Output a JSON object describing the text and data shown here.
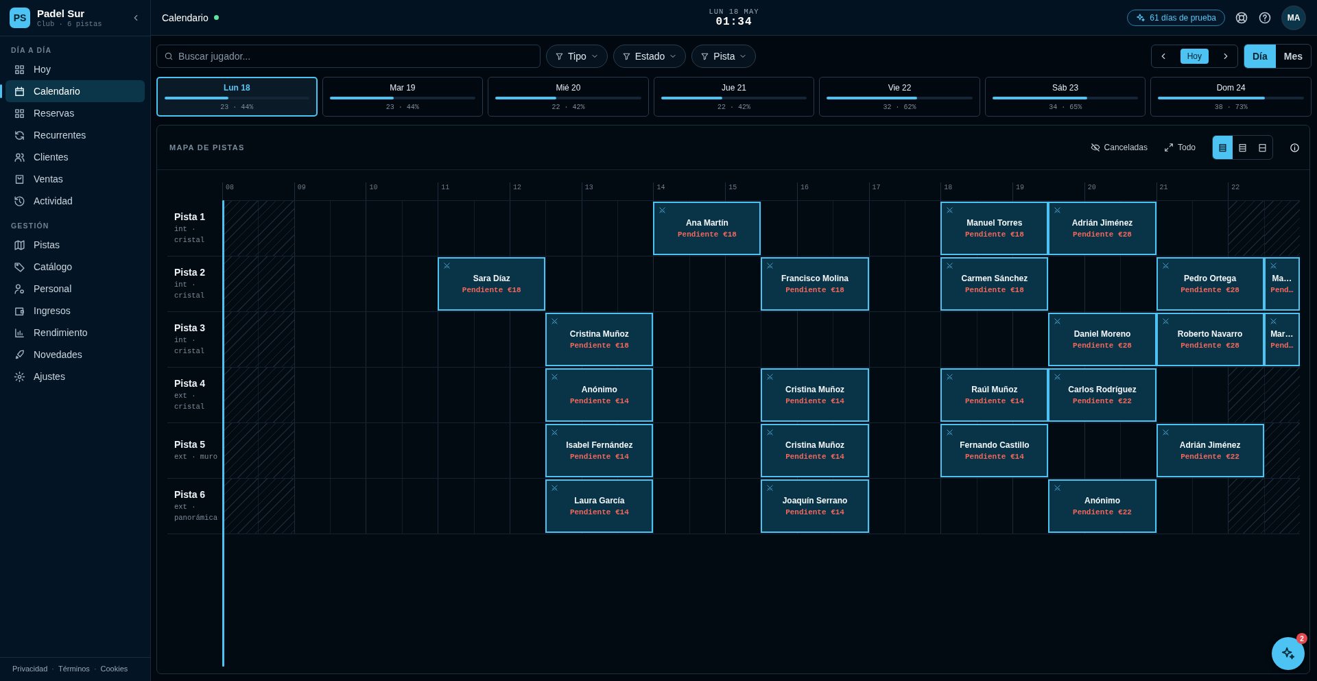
{
  "sidebar": {
    "logo": "PS",
    "club": "Padel Sur",
    "subtitle": "Club · 6 pistas",
    "sections": [
      {
        "title": "DÍA A DÍA",
        "items": [
          {
            "label": "Hoy",
            "selected": false
          },
          {
            "label": "Calendario",
            "selected": true
          },
          {
            "label": "Reservas",
            "selected": false
          },
          {
            "label": "Recurrentes",
            "selected": false
          },
          {
            "label": "Clientes",
            "selected": false
          },
          {
            "label": "Ventas",
            "selected": false
          },
          {
            "label": "Actividad",
            "selected": false
          }
        ]
      },
      {
        "title": "GESTIÓN",
        "items": [
          {
            "label": "Pistas",
            "selected": false
          },
          {
            "label": "Catálogo",
            "selected": false
          },
          {
            "label": "Personal",
            "selected": false
          },
          {
            "label": "Ingresos",
            "selected": false
          },
          {
            "label": "Rendimiento",
            "selected": false
          },
          {
            "label": "Novedades",
            "selected": false
          },
          {
            "label": "Ajustes",
            "selected": false
          }
        ]
      }
    ],
    "footer_links": [
      "Privacidad",
      "Términos",
      "Cookies"
    ],
    "separator": "·"
  },
  "header": {
    "title": "Calendario",
    "date": "LUN 18 MAY",
    "time": "01:34",
    "trial": "61 días de prueba",
    "avatar": "MA"
  },
  "toolbar": {
    "search": {
      "placeholder": "Buscar jugador..."
    },
    "filters": [
      "Tipo",
      "Estado",
      "Pista"
    ],
    "today": "Hoy",
    "views": [
      {
        "label": "Día",
        "selected": true
      },
      {
        "label": "Mes",
        "selected": false
      }
    ]
  },
  "days": [
    {
      "label": "Lun 18",
      "stats": "23 · 44%",
      "level": 0.44,
      "selected": true
    },
    {
      "label": "Mar 19",
      "stats": "23 · 44%",
      "level": 0.44,
      "selected": false
    },
    {
      "label": "Mié 20",
      "stats": "22 · 42%",
      "level": 0.42,
      "selected": false
    },
    {
      "label": "Jue 21",
      "stats": "22 · 42%",
      "level": 0.42,
      "selected": false
    },
    {
      "label": "Vie 22",
      "stats": "32 · 62%",
      "level": 0.62,
      "selected": false
    },
    {
      "label": "Sáb 23",
      "stats": "34 · 65%",
      "level": 0.65,
      "selected": false
    },
    {
      "label": "Dom 24",
      "stats": "38 · 73%",
      "level": 0.73,
      "selected": false
    }
  ],
  "map": {
    "title": "MAPA DE PISTAS",
    "actions": [
      "Canceladas",
      "Todo"
    ],
    "densities": [
      {
        "selected": true
      },
      {
        "selected": false
      },
      {
        "selected": false
      }
    ],
    "hours": [
      "08",
      "09",
      "10",
      "11",
      "12",
      "13",
      "14",
      "15",
      "16",
      "17",
      "18",
      "19",
      "20",
      "21",
      "22"
    ],
    "courts": [
      {
        "name": "Pista 1",
        "details": "int · cristal",
        "slots": [
          {
            "kind": "closed"
          },
          {
            "kind": "closed"
          },
          {
            "kind": "free"
          },
          {
            "kind": "free"
          },
          {
            "kind": "free"
          },
          {
            "kind": "free"
          },
          {
            "kind": "free"
          },
          {
            "kind": "free"
          },
          {
            "kind": "free"
          },
          {
            "kind": "free"
          },
          {
            "kind": "free"
          },
          {
            "kind": "free"
          },
          {
            "kind": "booking",
            "player": "Ana Martín",
            "status": "Pendiente €18"
          },
          {
            "kind": "free"
          },
          {
            "kind": "free"
          },
          {
            "kind": "free"
          },
          {
            "kind": "free"
          },
          {
            "kind": "free"
          },
          {
            "kind": "booking",
            "player": "Manuel Torres",
            "status": "Pendiente €18"
          },
          {
            "kind": "booking",
            "player": "Adrián Jiménez",
            "status": "Pendiente €28"
          },
          {
            "kind": "free"
          },
          {
            "kind": "free"
          },
          {
            "kind": "closed"
          },
          {
            "kind": "closed"
          }
        ]
      },
      {
        "name": "Pista 2",
        "details": "int · cristal",
        "slots": [
          {
            "kind": "closed"
          },
          {
            "kind": "closed"
          },
          {
            "kind": "free"
          },
          {
            "kind": "free"
          },
          {
            "kind": "free"
          },
          {
            "kind": "free"
          },
          {
            "kind": "booking",
            "player": "Sara Díaz",
            "status": "Pendiente €18"
          },
          {
            "kind": "free"
          },
          {
            "kind": "free"
          },
          {
            "kind": "free"
          },
          {
            "kind": "free"
          },
          {
            "kind": "free"
          },
          {
            "kind": "free"
          },
          {
            "kind": "booking",
            "player": "Francisco Molina",
            "status": "Pendiente €18"
          },
          {
            "kind": "free"
          },
          {
            "kind": "free"
          },
          {
            "kind": "booking",
            "player": "Carmen Sánchez",
            "status": "Pendiente €18"
          },
          {
            "kind": "free"
          },
          {
            "kind": "free"
          },
          {
            "kind": "free"
          },
          {
            "kind": "booking",
            "player": "Pedro Ortega",
            "status": "Pendiente €28"
          },
          {
            "kind": "booking_cut",
            "player": "Ma…",
            "status": "Pend…"
          }
        ]
      },
      {
        "name": "Pista 3",
        "details": "int · cristal",
        "slots": [
          {
            "kind": "closed"
          },
          {
            "kind": "closed"
          },
          {
            "kind": "free"
          },
          {
            "kind": "free"
          },
          {
            "kind": "free"
          },
          {
            "kind": "free"
          },
          {
            "kind": "free"
          },
          {
            "kind": "free"
          },
          {
            "kind": "free"
          },
          {
            "kind": "booking",
            "player": "Cristina Muñoz",
            "status": "Pendiente €18"
          },
          {
            "kind": "free"
          },
          {
            "kind": "free"
          },
          {
            "kind": "free"
          },
          {
            "kind": "free"
          },
          {
            "kind": "free"
          },
          {
            "kind": "free"
          },
          {
            "kind": "free"
          },
          {
            "kind": "free"
          },
          {
            "kind": "free"
          },
          {
            "kind": "free"
          },
          {
            "kind": "free"
          },
          {
            "kind": "booking",
            "player": "Daniel Moreno",
            "status": "Pendiente €28"
          },
          {
            "kind": "booking",
            "player": "Roberto Navarro",
            "status": "Pendiente €28"
          },
          {
            "kind": "booking_cut",
            "player": "Mar…",
            "status": "Pend…"
          }
        ]
      },
      {
        "name": "Pista 4",
        "details": "ext · cristal",
        "slots": [
          {
            "kind": "closed"
          },
          {
            "kind": "closed"
          },
          {
            "kind": "free"
          },
          {
            "kind": "free"
          },
          {
            "kind": "free"
          },
          {
            "kind": "free"
          },
          {
            "kind": "free"
          },
          {
            "kind": "free"
          },
          {
            "kind": "free"
          },
          {
            "kind": "booking",
            "player": "Anónimo",
            "status": "Pendiente €14"
          },
          {
            "kind": "free"
          },
          {
            "kind": "free"
          },
          {
            "kind": "free"
          },
          {
            "kind": "booking",
            "player": "Cristina Muñoz",
            "status": "Pendiente €14"
          },
          {
            "kind": "free"
          },
          {
            "kind": "free"
          },
          {
            "kind": "booking",
            "player": "Raúl Muñoz",
            "status": "Pendiente €14"
          },
          {
            "kind": "booking",
            "player": "Carlos Rodríguez",
            "status": "Pendiente €22"
          },
          {
            "kind": "free"
          },
          {
            "kind": "free"
          },
          {
            "kind": "closed"
          },
          {
            "kind": "closed"
          }
        ]
      },
      {
        "name": "Pista 5",
        "details": "ext · muro",
        "slots": [
          {
            "kind": "closed"
          },
          {
            "kind": "closed"
          },
          {
            "kind": "free"
          },
          {
            "kind": "free"
          },
          {
            "kind": "free"
          },
          {
            "kind": "free"
          },
          {
            "kind": "free"
          },
          {
            "kind": "free"
          },
          {
            "kind": "free"
          },
          {
            "kind": "booking",
            "player": "Isabel Fernández",
            "status": "Pendiente €14"
          },
          {
            "kind": "free"
          },
          {
            "kind": "free"
          },
          {
            "kind": "free"
          },
          {
            "kind": "booking",
            "player": "Cristina Muñoz",
            "status": "Pendiente €14"
          },
          {
            "kind": "free"
          },
          {
            "kind": "free"
          },
          {
            "kind": "booking",
            "player": "Fernando Castillo",
            "status": "Pendiente €14"
          },
          {
            "kind": "free"
          },
          {
            "kind": "free"
          },
          {
            "kind": "free"
          },
          {
            "kind": "booking",
            "player": "Adrián Jiménez",
            "status": "Pendiente €22"
          },
          {
            "kind": "closed"
          }
        ]
      },
      {
        "name": "Pista 6",
        "details": "ext · panorámica",
        "slots": [
          {
            "kind": "closed"
          },
          {
            "kind": "closed"
          },
          {
            "kind": "free"
          },
          {
            "kind": "free"
          },
          {
            "kind": "free"
          },
          {
            "kind": "free"
          },
          {
            "kind": "free"
          },
          {
            "kind": "free"
          },
          {
            "kind": "free"
          },
          {
            "kind": "booking",
            "player": "Laura García",
            "status": "Pendiente €14"
          },
          {
            "kind": "free"
          },
          {
            "kind": "free"
          },
          {
            "kind": "free"
          },
          {
            "kind": "booking",
            "player": "Joaquín Serrano",
            "status": "Pendiente €14"
          },
          {
            "kind": "free"
          },
          {
            "kind": "free"
          },
          {
            "kind": "free"
          },
          {
            "kind": "free"
          },
          {
            "kind": "free"
          },
          {
            "kind": "booking",
            "player": "Anónimo",
            "status": "Pendiente €22"
          },
          {
            "kind": "free"
          },
          {
            "kind": "free"
          },
          {
            "kind": "closed"
          },
          {
            "kind": "closed"
          }
        ]
      }
    ]
  },
  "assistant": {
    "badge": "2"
  }
}
